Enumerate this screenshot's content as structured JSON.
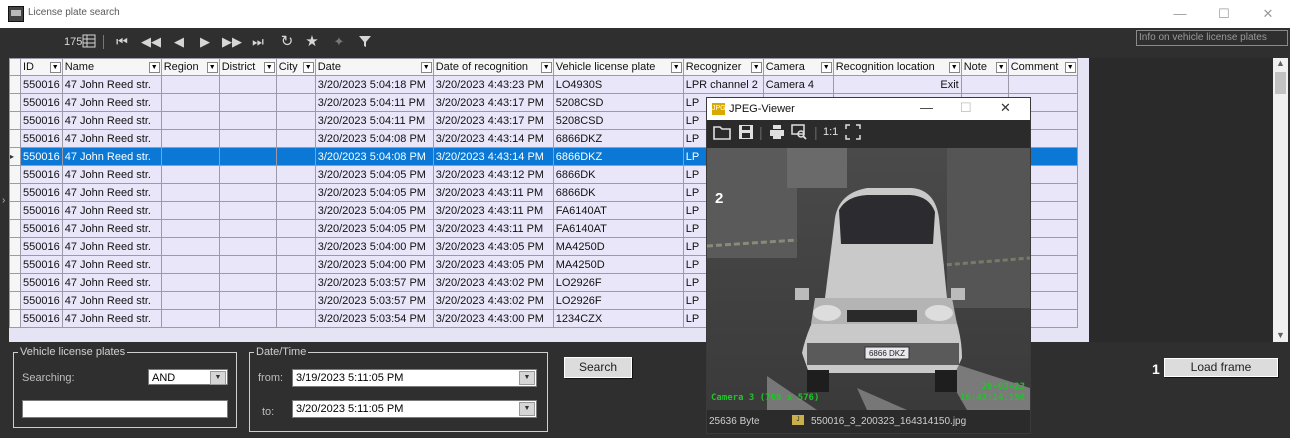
{
  "window": {
    "title": "License plate search",
    "controls": [
      "—",
      "☐",
      "✕"
    ]
  },
  "toolbar": {
    "record_count": "175",
    "icons": [
      "grid-icon",
      "first-icon",
      "prev-page-icon",
      "prev-icon",
      "next-icon",
      "next-page-icon",
      "last-icon",
      "refresh-icon",
      "favorite-icon",
      "add-favorite-icon",
      "filter-icon"
    ]
  },
  "info_box": "Info on vehicle license plates",
  "grid": {
    "columns": [
      "ID",
      "Name",
      "Region",
      "District",
      "City",
      "Date",
      "Date of recognition",
      "Vehicle license plate",
      "Recognizer",
      "Camera",
      "Recognition location",
      "Note",
      "Comment"
    ],
    "rows": [
      [
        "550016",
        "47 John Reed str.",
        "",
        "",
        "",
        "3/20/2023 5:04:18 PM",
        "3/20/2023 4:43:23 PM",
        "LO4930S",
        "LPR channel 2",
        "Camera 4",
        "Exit",
        "",
        ""
      ],
      [
        "550016",
        "47 John Reed str.",
        "",
        "",
        "",
        "3/20/2023 5:04:11 PM",
        "3/20/2023 4:43:17 PM",
        "5208CSD",
        "LP",
        "",
        "",
        "",
        ""
      ],
      [
        "550016",
        "47 John Reed str.",
        "",
        "",
        "",
        "3/20/2023 5:04:11 PM",
        "3/20/2023 4:43:17 PM",
        "5208CSD",
        "LP",
        "",
        "",
        "",
        ""
      ],
      [
        "550016",
        "47 John Reed str.",
        "",
        "",
        "",
        "3/20/2023 5:04:08 PM",
        "3/20/2023 4:43:14 PM",
        "6866DKZ",
        "LP",
        "",
        "",
        "",
        ""
      ],
      [
        "550016",
        "47 John Reed str.",
        "",
        "",
        "",
        "3/20/2023 5:04:08 PM",
        "3/20/2023 4:43:14 PM",
        "6866DKZ",
        "LP",
        "",
        "",
        "",
        ""
      ],
      [
        "550016",
        "47 John Reed str.",
        "",
        "",
        "",
        "3/20/2023 5:04:05 PM",
        "3/20/2023 4:43:12 PM",
        "6866DK",
        "LP",
        "",
        "",
        "",
        ""
      ],
      [
        "550016",
        "47 John Reed str.",
        "",
        "",
        "",
        "3/20/2023 5:04:05 PM",
        "3/20/2023 4:43:11 PM",
        "6866DK",
        "LP",
        "",
        "",
        "",
        ""
      ],
      [
        "550016",
        "47 John Reed str.",
        "",
        "",
        "",
        "3/20/2023 5:04:05 PM",
        "3/20/2023 4:43:11 PM",
        "FA6140AT",
        "LP",
        "",
        "",
        "",
        ""
      ],
      [
        "550016",
        "47 John Reed str.",
        "",
        "",
        "",
        "3/20/2023 5:04:05 PM",
        "3/20/2023 4:43:11 PM",
        "FA6140AT",
        "LP",
        "",
        "",
        "",
        ""
      ],
      [
        "550016",
        "47 John Reed str.",
        "",
        "",
        "",
        "3/20/2023 5:04:00 PM",
        "3/20/2023 4:43:05 PM",
        "MA4250D",
        "LP",
        "",
        "",
        "",
        ""
      ],
      [
        "550016",
        "47 John Reed str.",
        "",
        "",
        "",
        "3/20/2023 5:04:00 PM",
        "3/20/2023 4:43:05 PM",
        "MA4250D",
        "LP",
        "",
        "",
        "",
        ""
      ],
      [
        "550016",
        "47 John Reed str.",
        "",
        "",
        "",
        "3/20/2023 5:03:57 PM",
        "3/20/2023 4:43:02 PM",
        "LO2926F",
        "LP",
        "",
        "",
        "",
        ""
      ],
      [
        "550016",
        "47 John Reed str.",
        "",
        "",
        "",
        "3/20/2023 5:03:57 PM",
        "3/20/2023 4:43:02 PM",
        "LO2926F",
        "LP",
        "",
        "",
        "",
        ""
      ],
      [
        "550016",
        "47 John Reed str.",
        "",
        "",
        "",
        "3/20/2023 5:03:54 PM",
        "3/20/2023 4:43:00 PM",
        "1234CZX",
        "LP",
        "",
        "",
        "",
        ""
      ]
    ],
    "selected_row_index": 4
  },
  "plates_group": {
    "legend": "Vehicle license plates",
    "searching_label": "Searching:",
    "operator_value": "AND",
    "plate_input_value": ""
  },
  "datetime_group": {
    "legend": "Date/Time",
    "from_label": "from:",
    "from_value": "3/19/2023 5:11:05 PM",
    "to_label": "to:",
    "to_value": "3/20/2023 5:11:05 PM"
  },
  "search_button": "Search",
  "load_frame": {
    "marker": "1",
    "button": "Load frame"
  },
  "jpeg_viewer": {
    "title": "JPEG-Viewer",
    "app_badge": "JPG",
    "window_controls": [
      "—",
      "☐",
      "✕"
    ],
    "zoom_label": "1:1",
    "image_marker": "2",
    "plate_text": "6866 DKZ",
    "overlay_left": "Camera 3 (768 x 576)",
    "overlay_date": "20-03-23",
    "overlay_time": "16:43:14.150",
    "file_size": "25636 Byte",
    "file_name": "550016_3_200323_164314150.jpg",
    "overlay_color": "#22c22a"
  }
}
